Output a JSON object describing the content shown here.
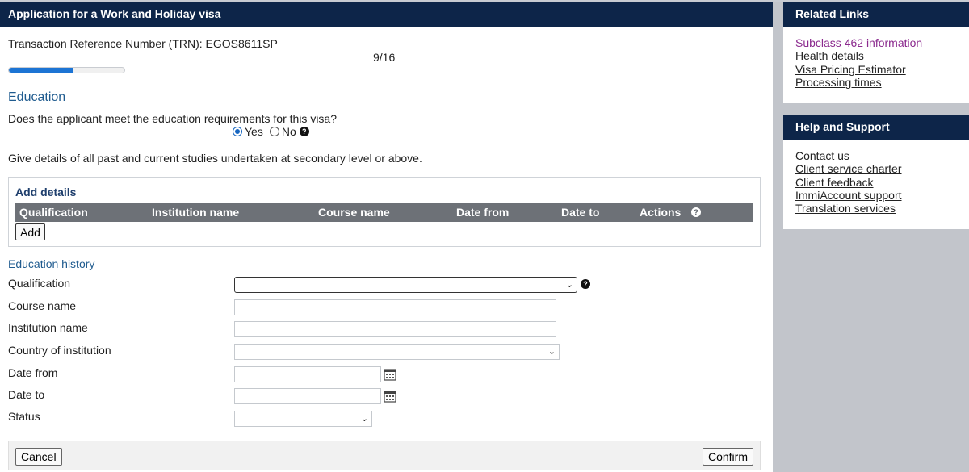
{
  "header": {
    "title": "Application for a Work and Holiday visa"
  },
  "trn": "Transaction Reference Number (TRN): EGOS8611SP",
  "step": "9/16",
  "progress_fraction": 0.5625,
  "education": {
    "title": "Education",
    "question": "Does the applicant meet the education requirements for this visa?",
    "yes_label": "Yes",
    "no_label": "No",
    "selected": "Yes",
    "instructions": "Give details of all past and current studies undertaken at secondary level or above."
  },
  "add_details": {
    "title": "Add details",
    "columns": [
      "Qualification",
      "Institution name",
      "Course name",
      "Date from",
      "Date to",
      "Actions"
    ],
    "add_button": "Add"
  },
  "history": {
    "title": "Education history",
    "fields": {
      "qualification": "Qualification",
      "course_name": "Course name",
      "institution_name": "Institution name",
      "country": "Country of institution",
      "date_from": "Date from",
      "date_to": "Date to",
      "status": "Status"
    }
  },
  "footer": {
    "cancel": "Cancel",
    "confirm": "Confirm"
  },
  "sidebar": {
    "related": {
      "title": "Related Links",
      "links": [
        "Subclass 462 information",
        "Health details",
        "Visa Pricing Estimator",
        "Processing times"
      ]
    },
    "help": {
      "title": "Help and Support",
      "links": [
        "Contact us",
        "Client service charter",
        "Client feedback",
        "ImmiAccount support",
        "Translation services"
      ]
    }
  },
  "colors": {
    "header_bg": "#0d2549",
    "progress_fill": "#1c74d4",
    "table_head": "#6d7177",
    "visited_link": "#8b2a8e"
  },
  "icons": {
    "help": "question-circle-icon",
    "calendar": "calendar-icon",
    "dropdown": "chevron-down-icon"
  }
}
